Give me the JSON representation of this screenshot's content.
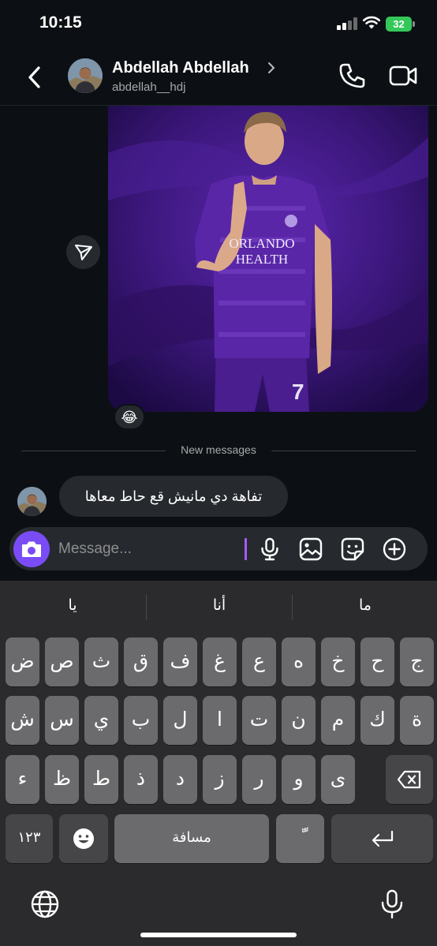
{
  "status_bar": {
    "time": "10:15",
    "battery": "32"
  },
  "header": {
    "name": "Abdellah Abdellah",
    "username": "abdellah__hdj"
  },
  "media": {
    "jersey_text_line1": "ORLANDO",
    "jersey_text_line2": "HEALTH",
    "shorts_number": "7",
    "reaction_emoji": "😂"
  },
  "divider": {
    "label": "New messages"
  },
  "messages": [
    {
      "text": "تفاهة دي مانيش قع حاط معاها",
      "direction": "received"
    }
  ],
  "composer": {
    "placeholder": "Message..."
  },
  "keyboard": {
    "suggestions": [
      "يا",
      "أنا",
      "ما"
    ],
    "row1": [
      "ض",
      "ص",
      "ث",
      "ق",
      "ف",
      "غ",
      "ع",
      "ه",
      "خ",
      "ح",
      "ج"
    ],
    "row2": [
      "ش",
      "س",
      "ي",
      "ب",
      "ل",
      "ا",
      "ت",
      "ن",
      "م",
      "ك",
      "ة"
    ],
    "row3": [
      "ء",
      "ظ",
      "ط",
      "ذ",
      "د",
      "ز",
      "ر",
      "و",
      "ى"
    ],
    "numbers_label": "١٢٣",
    "space_label": "مسافة",
    "diacritic_label": "ًّ"
  },
  "colors": {
    "background": "#0c1014",
    "bubble": "#262a2f",
    "accent": "#7a4cf5",
    "battery": "#34c759",
    "key": "#6b6b6d"
  },
  "icons": [
    "back-icon",
    "chevron-right-icon",
    "phone-icon",
    "video-camera-icon",
    "share-icon",
    "camera-icon",
    "microphone-icon",
    "gallery-icon",
    "sticker-icon",
    "plus-icon",
    "backspace-icon",
    "emoji-icon",
    "return-icon",
    "globe-icon",
    "dictation-icon"
  ]
}
